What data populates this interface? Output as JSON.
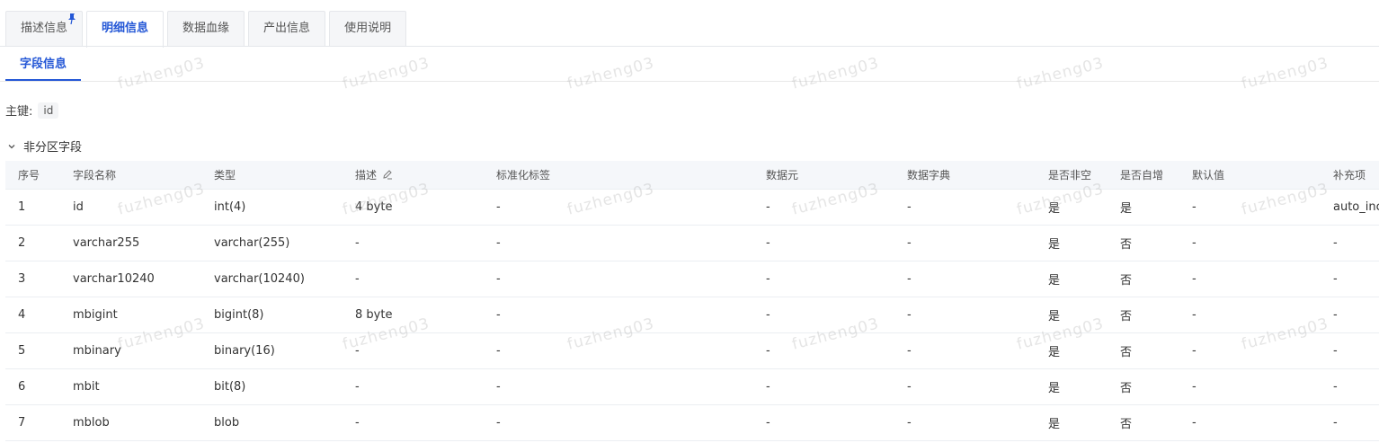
{
  "tabs": [
    {
      "label": "描述信息",
      "pinned": true
    },
    {
      "label": "明细信息",
      "active": true
    },
    {
      "label": "数据血缘"
    },
    {
      "label": "产出信息"
    },
    {
      "label": "使用说明"
    }
  ],
  "subtab": "字段信息",
  "primary_key": {
    "label": "主键:",
    "value": "id"
  },
  "section_title": "非分区字段",
  "columns": [
    "序号",
    "字段名称",
    "类型",
    "描述",
    "标准化标签",
    "数据元",
    "数据字典",
    "是否非空",
    "是否自增",
    "默认值",
    "补充项"
  ],
  "rows": [
    [
      "1",
      "id",
      "int(4)",
      "4 byte",
      "-",
      "-",
      "-",
      "是",
      "是",
      "-",
      "auto_increment"
    ],
    [
      "2",
      "varchar255",
      "varchar(255)",
      "-",
      "-",
      "-",
      "-",
      "是",
      "否",
      "-",
      "-"
    ],
    [
      "3",
      "varchar10240",
      "varchar(10240)",
      "-",
      "-",
      "-",
      "-",
      "是",
      "否",
      "-",
      "-"
    ],
    [
      "4",
      "mbigint",
      "bigint(8)",
      "8 byte",
      "-",
      "-",
      "-",
      "是",
      "否",
      "-",
      "-"
    ],
    [
      "5",
      "mbinary",
      "binary(16)",
      "-",
      "-",
      "-",
      "-",
      "是",
      "否",
      "-",
      "-"
    ],
    [
      "6",
      "mbit",
      "bit(8)",
      "-",
      "-",
      "-",
      "-",
      "是",
      "否",
      "-",
      "-"
    ],
    [
      "7",
      "mblob",
      "blob",
      "-",
      "-",
      "-",
      "-",
      "是",
      "否",
      "-",
      "-"
    ]
  ],
  "watermark": "fuzheng03",
  "colors": {
    "accent": "#2457d6",
    "header_bg": "#f5f7fa",
    "border": "#ebeef2"
  }
}
